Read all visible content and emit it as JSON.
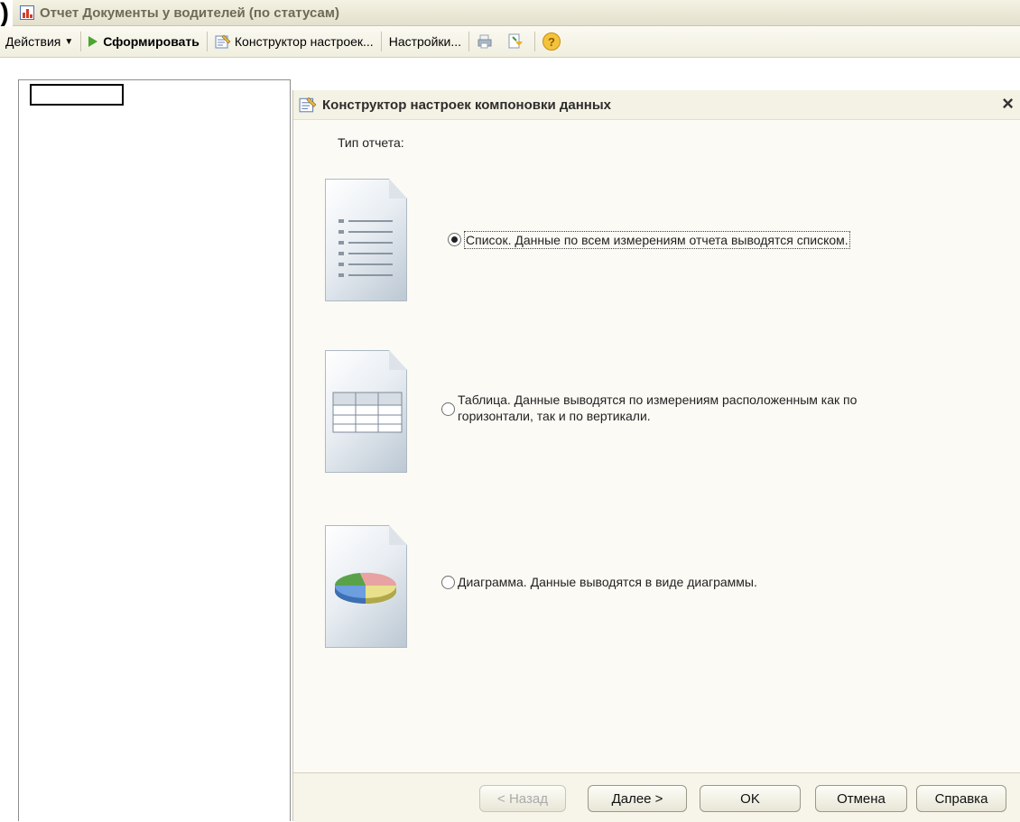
{
  "window": {
    "clipped_text": ")",
    "title": "Отчет  Документы у водителей (по статусам)"
  },
  "toolbar": {
    "actions_label": "Действия",
    "generate_label": "Сформировать",
    "constructor_label": "Конструктор настроек...",
    "settings_label": "Настройки..."
  },
  "dialog": {
    "title": "Конструктор настроек компоновки данных",
    "close_glyph": "×",
    "report_type_label": "Тип отчета:",
    "options": [
      {
        "label": "Список. Данные по всем измерениям отчета выводятся списком.",
        "selected": true
      },
      {
        "label_line1": "Таблица. Данные выводятся по измерениям расположенным как по",
        "label_line2": "горизонтали, так и по вертикали.",
        "selected": false
      },
      {
        "label": "Диаграмма. Данные выводятся в виде диаграммы.",
        "selected": false
      }
    ],
    "buttons": {
      "back": "< Назад",
      "next": "Далее >",
      "ok": "OK",
      "cancel": "Отмена",
      "help": "Справка"
    }
  },
  "icons": [
    "report-icon",
    "play-icon",
    "constructor-icon",
    "print-icon",
    "export-icon",
    "help-icon",
    "list-doc-icon",
    "table-doc-icon",
    "chart-doc-icon"
  ],
  "colors": {
    "accent_green": "#4aa531",
    "title_text": "#6e6a56",
    "dialog_bg": "#fbfaf5"
  }
}
